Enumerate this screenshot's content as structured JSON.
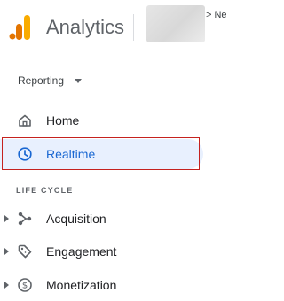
{
  "header": {
    "app_title": "Analytics",
    "breadcrumb": "> Ne",
    "logo_colors": [
      "#f9ab00",
      "#e37400"
    ]
  },
  "nav": {
    "reporting_label": "Reporting",
    "items": [
      {
        "label": "Home",
        "icon": "home-icon"
      },
      {
        "label": "Realtime",
        "icon": "clock-icon",
        "selected": true,
        "accent": "#1967d2"
      }
    ],
    "section_label": "LIFE CYCLE",
    "lifecycle": [
      {
        "label": "Acquisition",
        "icon": "acquisition-icon"
      },
      {
        "label": "Engagement",
        "icon": "tag-icon"
      },
      {
        "label": "Monetization",
        "icon": "dollar-icon"
      }
    ]
  }
}
